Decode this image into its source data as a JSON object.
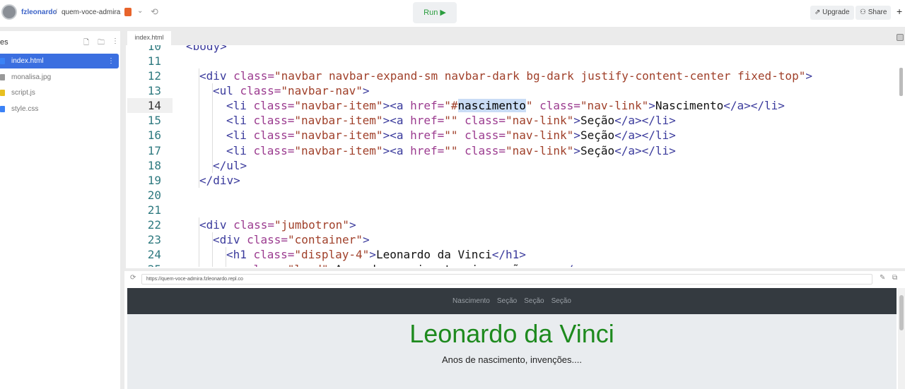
{
  "topbar": {
    "user": "fzleonardo",
    "separator": "/",
    "repl": "quem-voce-admira",
    "run_label": "Run ▶",
    "upgrade_label": "⇗ Upgrade",
    "share_label": "⚇ Share",
    "plus": "+"
  },
  "files": {
    "title": "es",
    "items": [
      {
        "name": "index.html",
        "color": "#3b82f6"
      },
      {
        "name": "monalisa.jpg",
        "color": "#999999"
      },
      {
        "name": "script.js",
        "color": "#e8c020"
      },
      {
        "name": "style.css",
        "color": "#3b82f6"
      }
    ]
  },
  "editor": {
    "tab": "index.html",
    "active_line": 14,
    "lines": [
      {
        "n": "10",
        "indent": 0,
        "tokens": [
          [
            "t",
            "<body>"
          ]
        ]
      },
      {
        "n": "11",
        "indent": 0,
        "tokens": []
      },
      {
        "n": "12",
        "indent": 1,
        "tokens": [
          [
            "t",
            "<div "
          ],
          [
            "a",
            "class="
          ],
          [
            "s",
            "\"navbar navbar-expand-sm navbar-dark bg-dark justify-content-center fixed-top\""
          ],
          [
            "t",
            ">"
          ]
        ]
      },
      {
        "n": "13",
        "indent": 2,
        "tokens": [
          [
            "t",
            "<ul "
          ],
          [
            "a",
            "class="
          ],
          [
            "s",
            "\"navbar-nav\""
          ],
          [
            "t",
            ">"
          ]
        ]
      },
      {
        "n": "14",
        "indent": 3,
        "tokens": [
          [
            "t",
            "<li "
          ],
          [
            "a",
            "class="
          ],
          [
            "s",
            "\"navbar-item\""
          ],
          [
            "t",
            "><a "
          ],
          [
            "a",
            "href="
          ],
          [
            "s",
            "\"#"
          ],
          [
            "hl",
            "nascimento"
          ],
          [
            "s",
            "\" "
          ],
          [
            "a",
            "class="
          ],
          [
            "s",
            "\"nav-link\""
          ],
          [
            "t",
            ">"
          ],
          [
            "x",
            "Nascimento"
          ],
          [
            "t",
            "</a></li>"
          ]
        ]
      },
      {
        "n": "15",
        "indent": 3,
        "tokens": [
          [
            "t",
            "<li "
          ],
          [
            "a",
            "class="
          ],
          [
            "s",
            "\"navbar-item\""
          ],
          [
            "t",
            "><a "
          ],
          [
            "a",
            "href="
          ],
          [
            "s",
            "\"\" "
          ],
          [
            "a",
            "class="
          ],
          [
            "s",
            "\"nav-link\""
          ],
          [
            "t",
            ">"
          ],
          [
            "x",
            "Seção"
          ],
          [
            "t",
            "</a></li>"
          ]
        ]
      },
      {
        "n": "16",
        "indent": 3,
        "tokens": [
          [
            "t",
            "<li "
          ],
          [
            "a",
            "class="
          ],
          [
            "s",
            "\"navbar-item\""
          ],
          [
            "t",
            "><a "
          ],
          [
            "a",
            "href="
          ],
          [
            "s",
            "\"\" "
          ],
          [
            "a",
            "class="
          ],
          [
            "s",
            "\"nav-link\""
          ],
          [
            "t",
            ">"
          ],
          [
            "x",
            "Seção"
          ],
          [
            "t",
            "</a></li>"
          ]
        ]
      },
      {
        "n": "17",
        "indent": 3,
        "tokens": [
          [
            "t",
            "<li "
          ],
          [
            "a",
            "class="
          ],
          [
            "s",
            "\"navbar-item\""
          ],
          [
            "t",
            "><a "
          ],
          [
            "a",
            "href="
          ],
          [
            "s",
            "\"\" "
          ],
          [
            "a",
            "class="
          ],
          [
            "s",
            "\"nav-link\""
          ],
          [
            "t",
            ">"
          ],
          [
            "x",
            "Seção"
          ],
          [
            "t",
            "</a></li>"
          ]
        ]
      },
      {
        "n": "18",
        "indent": 2,
        "tokens": [
          [
            "t",
            "</ul>"
          ]
        ]
      },
      {
        "n": "19",
        "indent": 1,
        "tokens": [
          [
            "t",
            "</div>"
          ]
        ]
      },
      {
        "n": "20",
        "indent": 0,
        "tokens": []
      },
      {
        "n": "21",
        "indent": 0,
        "tokens": []
      },
      {
        "n": "22",
        "indent": 1,
        "tokens": [
          [
            "t",
            "<div "
          ],
          [
            "a",
            "class="
          ],
          [
            "s",
            "\"jumbotron\""
          ],
          [
            "t",
            ">"
          ]
        ]
      },
      {
        "n": "23",
        "indent": 2,
        "tokens": [
          [
            "t",
            "<div "
          ],
          [
            "a",
            "class="
          ],
          [
            "s",
            "\"container\""
          ],
          [
            "t",
            ">"
          ]
        ]
      },
      {
        "n": "24",
        "indent": 3,
        "tokens": [
          [
            "t",
            "<h1 "
          ],
          [
            "a",
            "class="
          ],
          [
            "s",
            "\"display-4\""
          ],
          [
            "t",
            ">"
          ],
          [
            "x",
            "Leonardo da Vinci"
          ],
          [
            "t",
            "</h1>"
          ]
        ]
      },
      {
        "n": "25",
        "indent": 3,
        "tokens": [
          [
            "t",
            "<p "
          ],
          [
            "a",
            "class="
          ],
          [
            "s",
            "\"lead\""
          ],
          [
            "t",
            ">"
          ],
          [
            "x",
            "Anos de nascimento, invenções...."
          ],
          [
            "t",
            "</p>"
          ]
        ]
      }
    ]
  },
  "preview": {
    "url": "https://quem-voce-admira.fzleonardo.repl.co",
    "nav_links": [
      "Nascimento",
      "Seção",
      "Seção",
      "Seção"
    ],
    "heading": "Leonardo da Vinci",
    "lead": "Anos de nascimento, invenções...."
  }
}
